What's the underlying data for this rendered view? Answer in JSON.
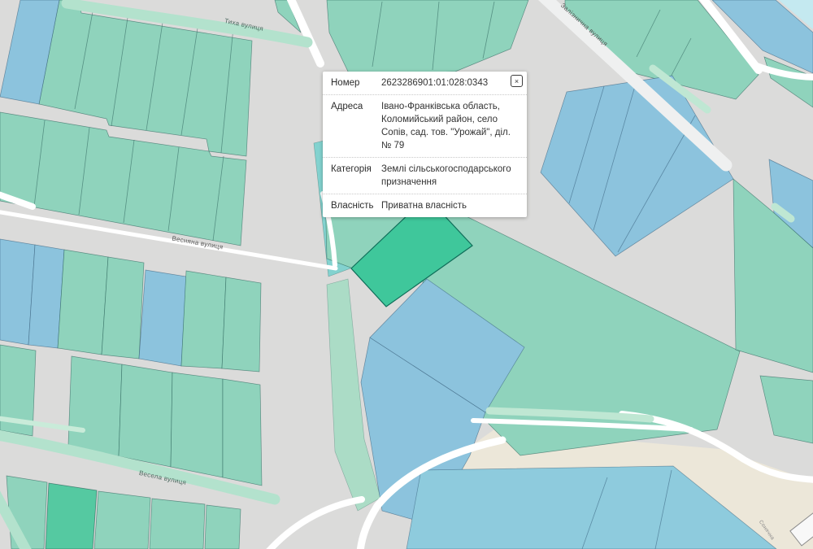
{
  "popup": {
    "close_label": "×",
    "rows": [
      {
        "label": "Номер",
        "value": "2623286901:01:028:0343"
      },
      {
        "label": "Адреса",
        "value": "Івано-Франківська область, Коломийський район, село Сопів, сад. тов. \"Урожай\", діл. № 79"
      },
      {
        "label": "Категорія",
        "value": "Землі сільськогосподарського призначення"
      },
      {
        "label": "Власність",
        "value": "Приватна власність"
      }
    ]
  },
  "streets": {
    "tykha": "Тиха вулиця",
    "vesniana": "Весняна вулиця",
    "vesela": "Весела вулиця",
    "zaliznychna": "Залізнична вулиця",
    "soniachna": "Сонячна"
  },
  "colors": {
    "background": "#dbdbda",
    "parcel_green": "#8fd3bc",
    "parcel_green_bright": "#55c9a1",
    "parcel_selected": "#3fc79b",
    "parcel_blue": "#8cc3dd",
    "parcel_blue_big": "#8ecbdd",
    "teal_wedge": "#83d2cf",
    "light_green_strip": "#abdcc6",
    "road_teal": "#b3e2cd",
    "road_white": "#ffffff",
    "road_light": "#eff0f0",
    "beige": "#ece7d9",
    "cyan_corner": "#c4e9f0"
  }
}
